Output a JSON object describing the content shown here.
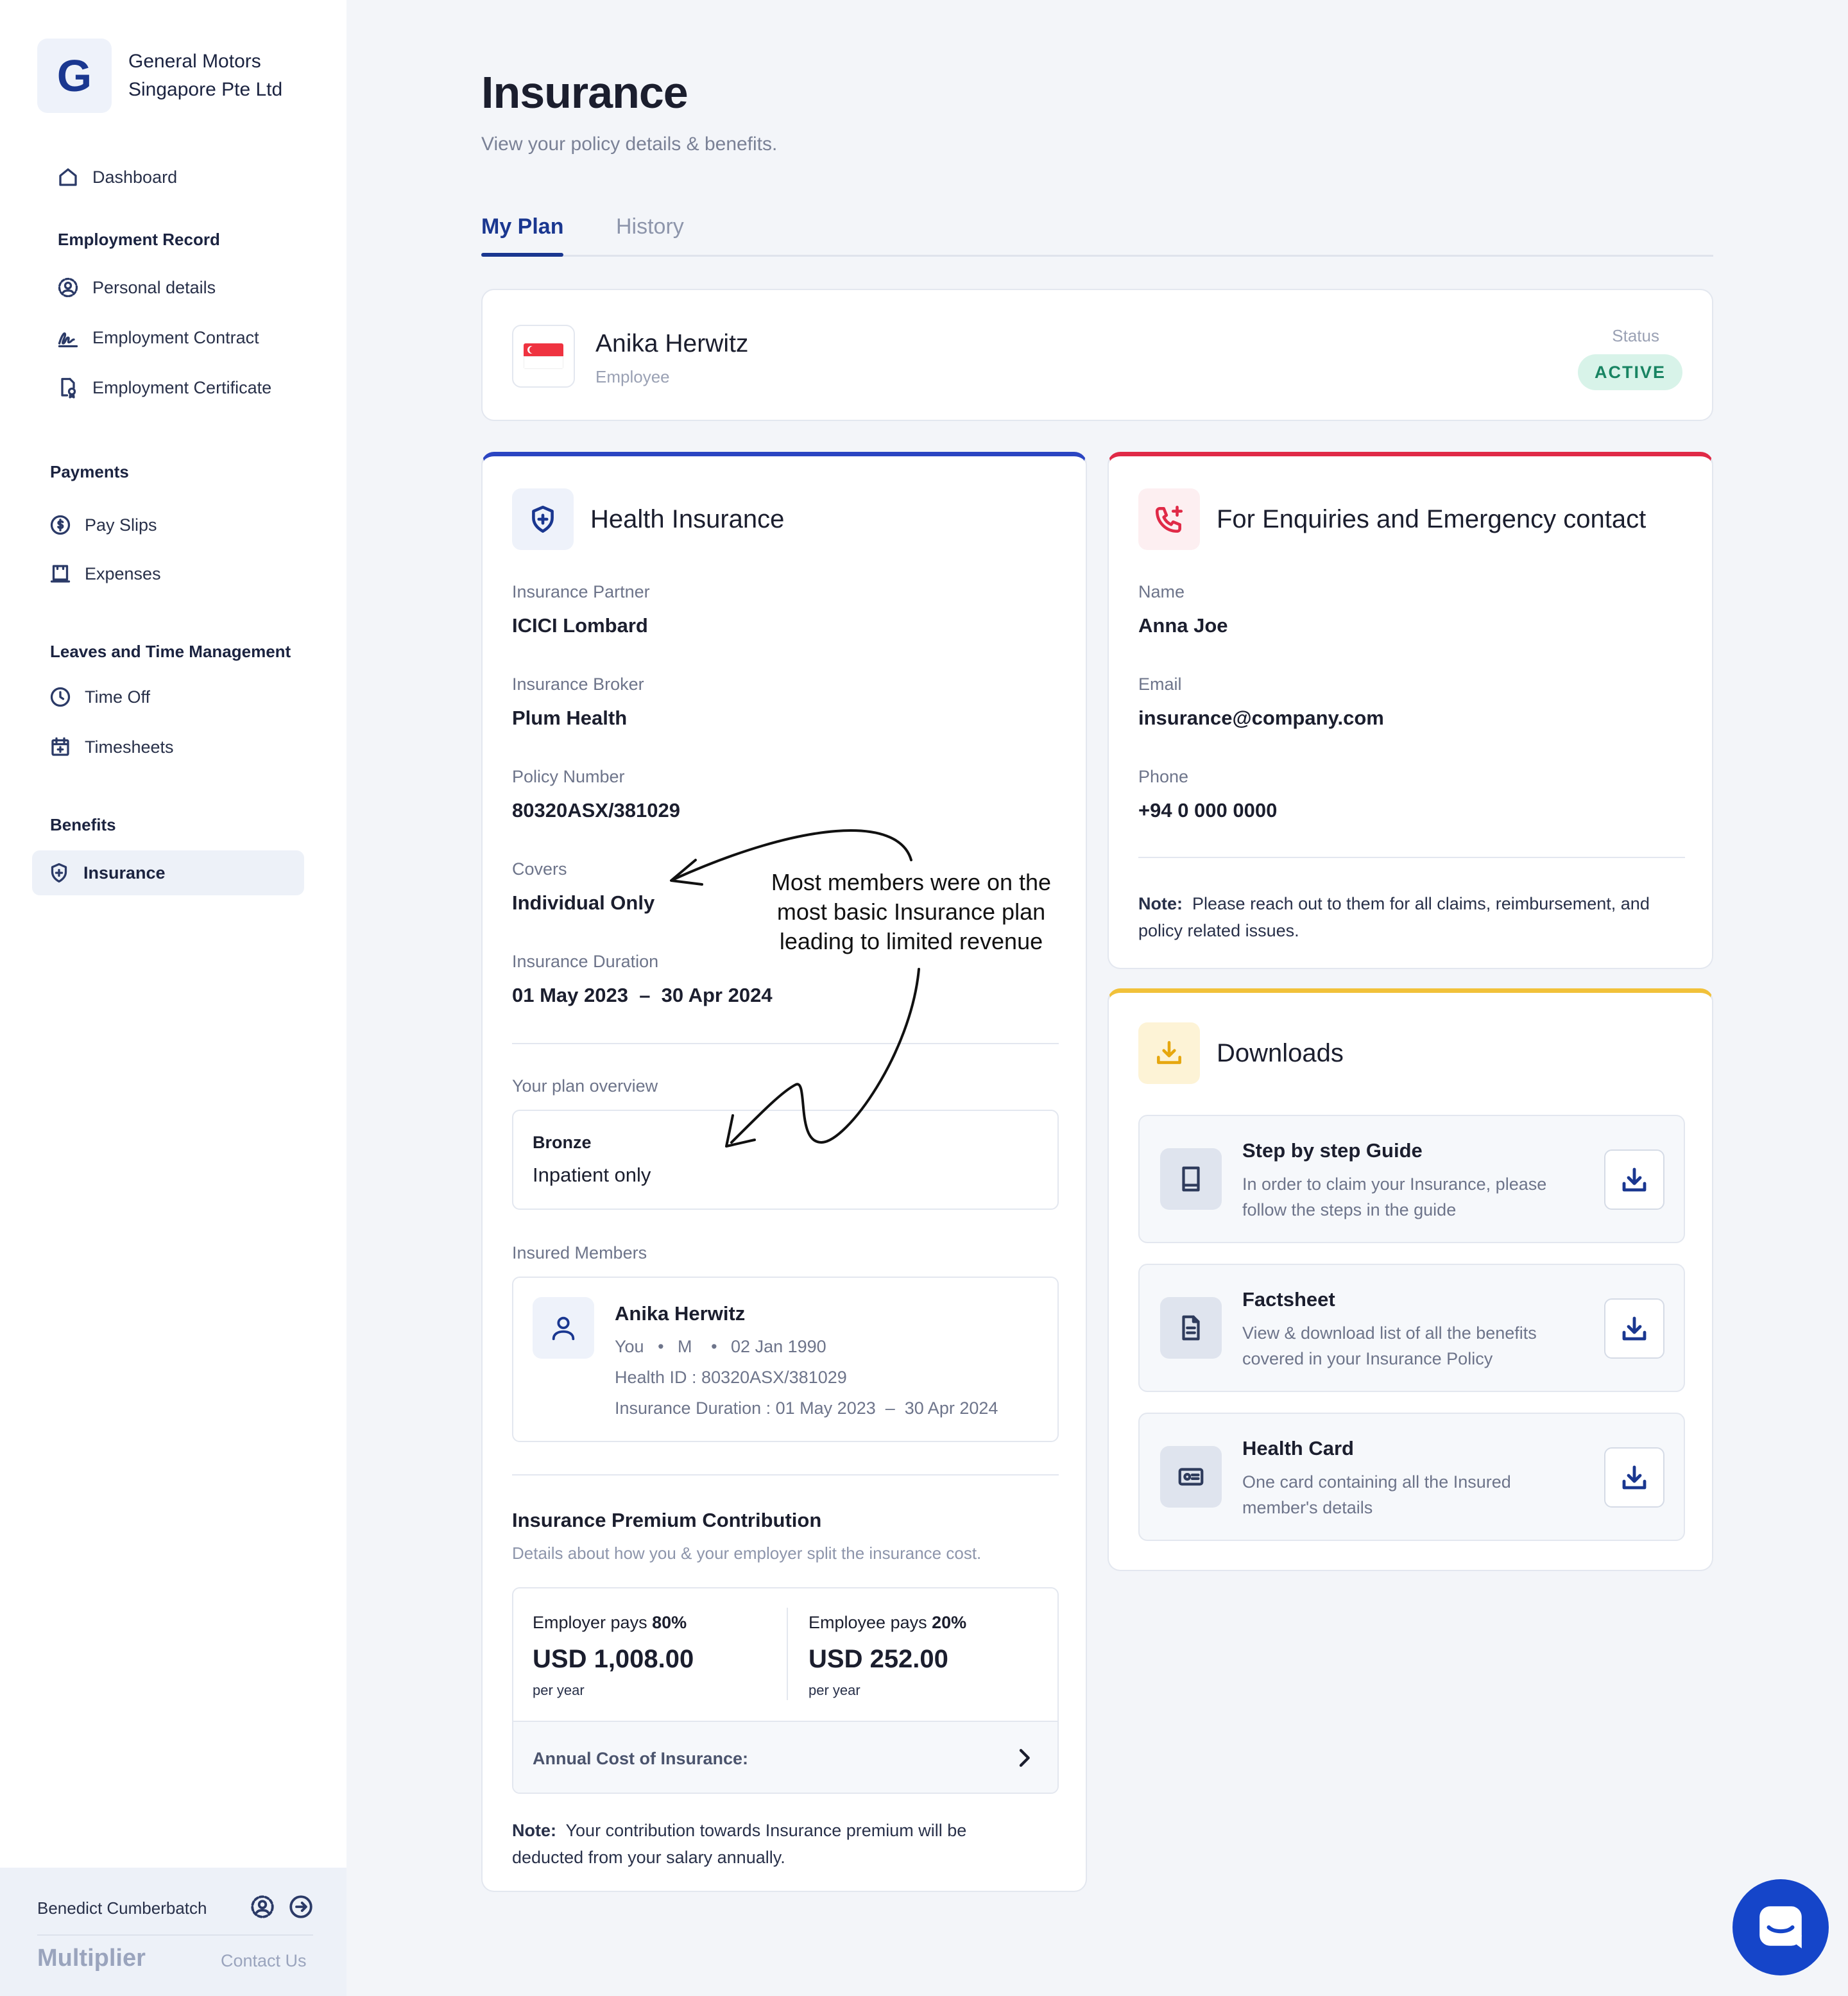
{
  "company": {
    "logo_letter": "G",
    "name": "General Motors Singapore Pte Ltd"
  },
  "sidebar": {
    "dashboard": "Dashboard",
    "sections": {
      "employment": "Employment Record",
      "payments": "Payments",
      "leaves": "Leaves and Time Management",
      "benefits": "Benefits"
    },
    "items": {
      "personal": "Personal details",
      "contract": "Employment Contract",
      "certificate": "Employment Certificate",
      "payslips": "Pay Slips",
      "expenses": "Expenses",
      "timeoff": "Time Off",
      "timesheets": "Timesheets",
      "insurance": "Insurance"
    },
    "footer": {
      "user": "Benedict Cumberbatch",
      "brand": "Multiplier",
      "contact": "Contact Us"
    }
  },
  "header": {
    "title": "Insurance",
    "subtitle": "View your policy details & benefits."
  },
  "tabs": {
    "my_plan": "My Plan",
    "history": "History"
  },
  "profile": {
    "name": "Anika Herwitz",
    "role": "Employee",
    "status_label": "Status",
    "status": "ACTIVE"
  },
  "health": {
    "title": "Health Insurance",
    "partner_label": "Insurance Partner",
    "partner": "ICICI Lombard",
    "broker_label": "Insurance Broker",
    "broker": "Plum Health",
    "policy_label": "Policy Number",
    "policy": "80320ASX/381029",
    "covers_label": "Covers",
    "covers": "Individual Only",
    "duration_label": "Insurance Duration",
    "duration": "01 May 2023  –  30 Apr 2024",
    "overview_label": "Your plan overview",
    "plan_tier": "Bronze",
    "plan_desc": "Inpatient only",
    "members_label": "Insured Members",
    "member": {
      "name": "Anika Herwitz",
      "meta_you": "You",
      "meta_gender": "M",
      "meta_dob": "02 Jan 1990",
      "health_id": "Health ID : 80320ASX/381029",
      "duration": "Insurance Duration : 01 May 2023  –  30 Apr 2024"
    },
    "premium_title": "Insurance Premium Contribution",
    "premium_sub": "Details about how you & your employer split the insurance cost.",
    "employer_label": "Employer pays ",
    "employer_pct": "80%",
    "employer_amount": "USD 1,008.00",
    "employer_period": "per year",
    "employee_label": "Employee pays ",
    "employee_pct": "20%",
    "employee_amount": "USD 252.00",
    "employee_period": "per year",
    "annual_label": "Annual Cost of Insurance:",
    "note_label": "Note:",
    "note": "Your contribution towards Insurance premium will be deducted from your salary annually."
  },
  "annotation": {
    "line1": "Most members were on the",
    "line2": "most basic Insurance plan",
    "line3": "leading to limited revenue"
  },
  "contact": {
    "title": "For Enquiries and Emergency contact",
    "name_label": "Name",
    "name": "Anna Joe",
    "email_label": "Email",
    "email": "insurance@company.com",
    "phone_label": "Phone",
    "phone": "+94 0 000 0000",
    "note_label": "Note:",
    "note": "Please reach out to them for all claims, reimbursement, and policy related issues."
  },
  "downloads": {
    "title": "Downloads",
    "items": [
      {
        "title": "Step by step Guide",
        "desc": "In order to claim your Insurance, please follow the steps in the guide",
        "icon": "book-icon"
      },
      {
        "title": "Factsheet",
        "desc": "View & download list of all the benefits covered in your Insurance Policy",
        "icon": "document-icon"
      },
      {
        "title": "Health Card",
        "desc": "One card containing all the Insured member's details",
        "icon": "id-card-icon"
      }
    ]
  },
  "colors": {
    "primary": "#1a3790",
    "health_accent": "#2b45c2",
    "contact_accent": "#e02a47",
    "downloads_accent": "#f1c13a",
    "status_bg": "#d8f3e9",
    "status_text": "#188462",
    "chat": "#1545c9"
  }
}
